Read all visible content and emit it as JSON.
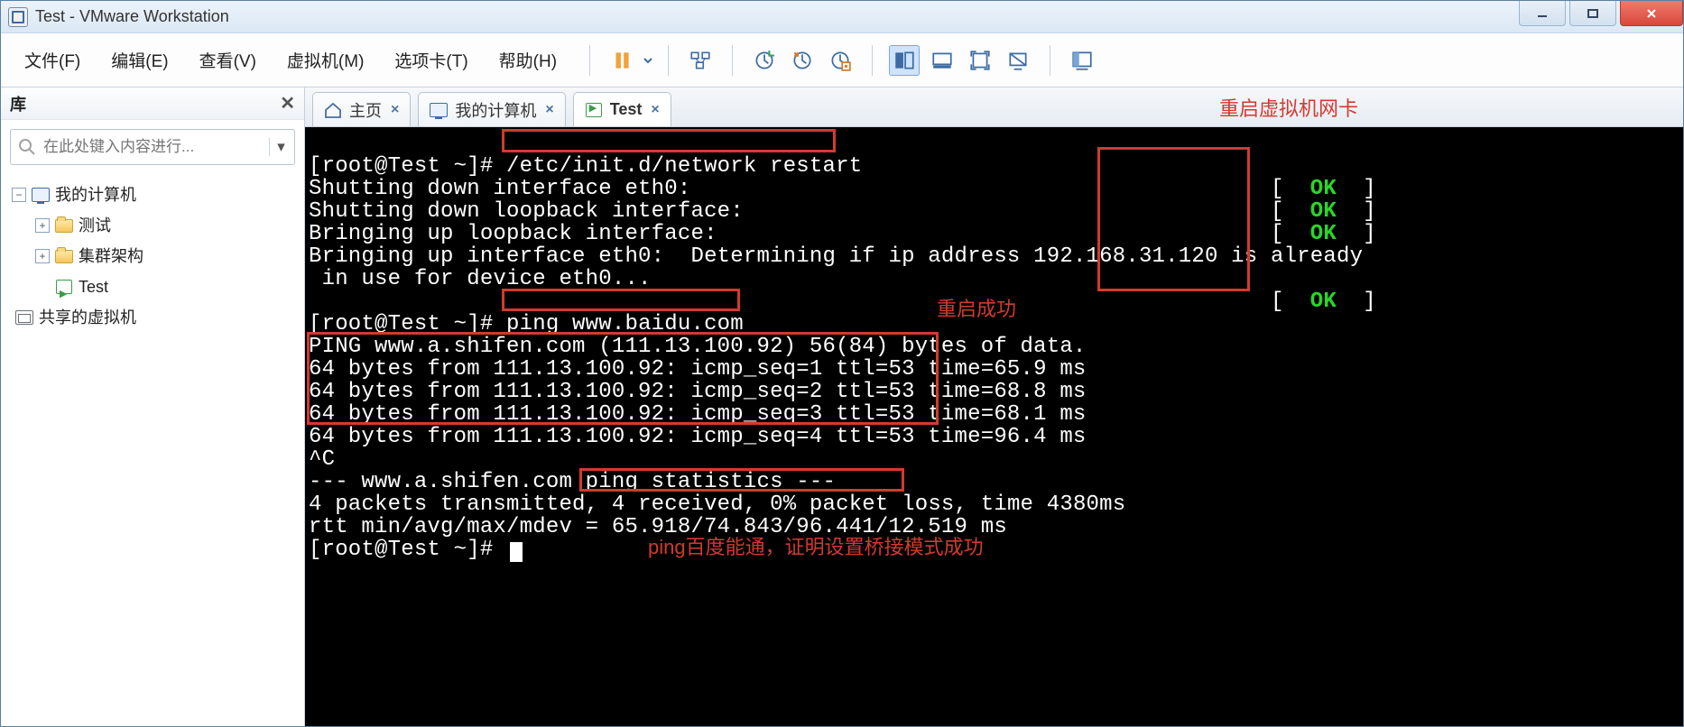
{
  "window": {
    "title": "Test - VMware Workstation"
  },
  "menus": {
    "file": "文件(F)",
    "edit": "编辑(E)",
    "view": "查看(V)",
    "vm": "虚拟机(M)",
    "tabs": "选项卡(T)",
    "help": "帮助(H)"
  },
  "sidebar": {
    "title": "库",
    "search_placeholder": "在此处键入内容进行...",
    "items": {
      "root": "我的计算机",
      "child1": "测试",
      "child2": "集群架构",
      "child3": "Test",
      "shared": "共享的虚拟机"
    }
  },
  "tabs": {
    "home": "主页",
    "mycomputer": "我的计算机",
    "test": "Test"
  },
  "annotations": {
    "restart_nic": "重启虚拟机网卡",
    "restart_ok": "重启成功",
    "ping_ok": "ping百度能通，证明设置桥接模式成功"
  },
  "terminal": {
    "prompt1": "[root@Test ~]# ",
    "cmd1": "/etc/init.d/network restart",
    "l1": "Shutting down interface eth0:",
    "l2": "Shutting down loopback interface:",
    "l3": "Bringing up loopback interface:",
    "l4a": "Bringing up interface eth0:  Determining if ip address 192",
    "l4b": ".168.31.120 is already",
    "l5": " in use for device eth0...",
    "ok": "OK",
    "prompt2": "[root@Test ~]# ",
    "cmd2": "ping www.baidu.com",
    "ping_header": "PING www.a.shifen.com (111.13.100.92) 56(84) bytes of data.",
    "p1": "64 bytes from 111.13.100.92: icmp_seq=1 ttl=53 time=65.9 ms",
    "p2": "64 bytes from 111.13.100.92: icmp_seq=2 ttl=53 time=68.8 ms",
    "p3": "64 bytes from 111.13.100.92: icmp_seq=3 ttl=53 time=68.1 ms",
    "p4": "64 bytes from 111.13.100.92: icmp_seq=4 ttl=53 time=96.4 ms",
    "ctrl_c": "^C",
    "stat1": "--- www.a.shifen.com ping statistics ---",
    "stat2a": "4 packets transmitted,",
    "stat2b": " 4 received, 0% packet loss",
    "stat2c": ", time 4380ms",
    "stat3": "rtt min/avg/max/mdev = 65.918/74.843/96.441/12.519 ms",
    "prompt3": "[root@Test ~]# "
  }
}
